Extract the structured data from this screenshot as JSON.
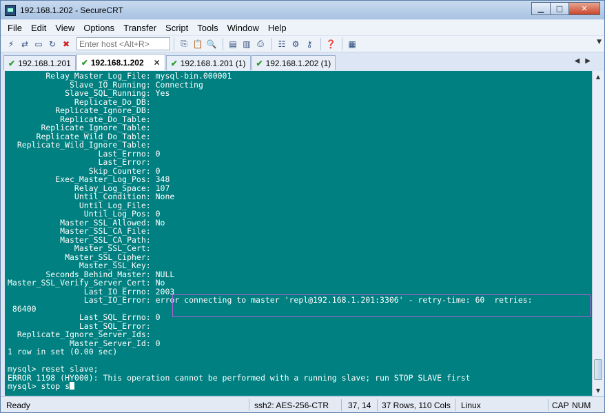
{
  "window": {
    "title": "192.168.1.202 - SecureCRT"
  },
  "menu": [
    "File",
    "Edit",
    "View",
    "Options",
    "Transfer",
    "Script",
    "Tools",
    "Window",
    "Help"
  ],
  "toolbar": {
    "host_placeholder": "Enter host <Alt+R>"
  },
  "tabs": [
    {
      "label": "192.168.1.201",
      "active": false,
      "connected": true
    },
    {
      "label": "192.168.1.202",
      "active": true,
      "connected": true
    },
    {
      "label": "192.168.1.201 (1)",
      "active": false,
      "connected": true
    },
    {
      "label": "192.168.1.202 (1)",
      "active": false,
      "connected": true
    }
  ],
  "terminal": {
    "background": "#008080",
    "foreground": "#ffffff",
    "lines": [
      "        Relay_Master_Log_File: mysql-bin.000001",
      "             Slave_IO_Running: Connecting",
      "            Slave_SQL_Running: Yes",
      "              Replicate_Do_DB:",
      "          Replicate_Ignore_DB:",
      "           Replicate_Do_Table:",
      "       Replicate_Ignore_Table:",
      "      Replicate_Wild_Do_Table:",
      "  Replicate_Wild_Ignore_Table:",
      "                   Last_Errno: 0",
      "                   Last_Error:",
      "                 Skip_Counter: 0",
      "          Exec_Master_Log_Pos: 348",
      "              Relay_Log_Space: 107",
      "              Until_Condition: None",
      "               Until_Log_File:",
      "                Until_Log_Pos: 0",
      "           Master_SSL_Allowed: No",
      "           Master_SSL_CA_File:",
      "           Master_SSL_CA_Path:",
      "              Master_SSL_Cert:",
      "            Master_SSL_Cipher:",
      "               Master_SSL_Key:",
      "        Seconds_Behind_Master: NULL",
      "Master_SSL_Verify_Server_Cert: No",
      "                Last_IO_Errno: 2003",
      "                Last_IO_Error: error connecting to master 'repl@192.168.1.201:3306' - retry-time: 60  retries:",
      " 86400",
      "               Last_SQL_Errno: 0",
      "               Last_SQL_Error:",
      "  Replicate_Ignore_Server_Ids:",
      "             Master_Server_Id: 0",
      "1 row in set (0.00 sec)",
      "",
      "mysql> reset slave;",
      "ERROR 1198 (HY000): This operation cannot be performed with a running slave; run STOP SLAVE first"
    ],
    "prompt_line": "mysql> stop s"
  },
  "status": {
    "ready": "Ready",
    "cipher": "ssh2: AES-256-CTR",
    "cursor_pos": "37, 14",
    "size": "37 Rows, 110 Cols",
    "term": "Linux",
    "caps": "CAP",
    "num": "NUM"
  }
}
